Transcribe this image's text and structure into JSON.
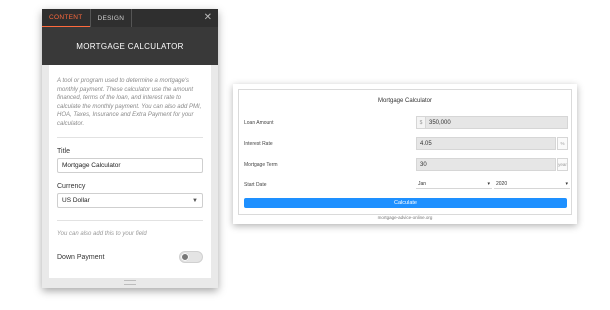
{
  "panel": {
    "tabs": [
      {
        "label": "CONTENT",
        "active": true
      },
      {
        "label": "DESIGN",
        "active": false
      }
    ],
    "close_glyph": "✕",
    "header_title": "MORTGAGE CALCULATOR",
    "description": "A tool or program used to determine a mortgage's monthly payment. These calculator use the amount financed, terms of the loan, and interest rate to calculate the monthly payment. You can also add PMI, HOA, Taxes, Insurance and Extra Payment for your calculator.",
    "title_label": "Title",
    "title_value": "Mortgage Calculator",
    "currency_label": "Currency",
    "currency_value": "US Dollar",
    "add_note": "You can also add this to your field",
    "down_payment_label": "Down Payment",
    "down_payment_enabled": false,
    "accent_color": "#ff6a3d"
  },
  "preview": {
    "title": "Mortgage Calculator",
    "fields": {
      "loan_amount": {
        "label": "Loan Amount",
        "prefix": "$",
        "value": "350,000"
      },
      "interest_rate": {
        "label": "Interest Rate",
        "value": "4.05",
        "suffix": "%"
      },
      "mortgage_term": {
        "label": "Mortgage Term",
        "value": "30",
        "suffix": "year"
      },
      "start_date": {
        "label": "Start Date",
        "month": "Jan",
        "year": "2020"
      }
    },
    "button_label": "Calculate",
    "button_color": "#1e90ff",
    "footer": "mortgage-advice-online.org"
  }
}
